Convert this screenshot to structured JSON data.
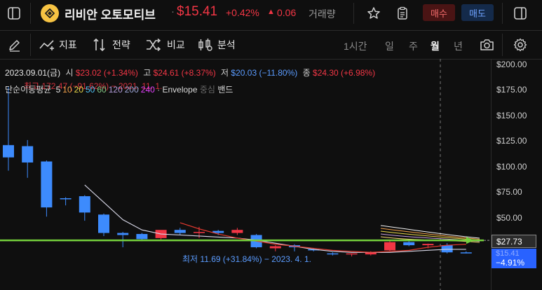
{
  "header": {
    "symbol_name": "리비안 오토모티브",
    "price": "$15.41",
    "change_pct": "+0.42%",
    "change_abs": "0.06",
    "volume_label": "거래량",
    "buy_label": "매수",
    "sell_label": "매도"
  },
  "toolbar": {
    "indicators_label": "지표",
    "strategy_label": "전략",
    "compare_label": "비교",
    "analysis_label": "분석",
    "timeframes": [
      "1시간",
      "일",
      "주",
      "월",
      "년"
    ],
    "active_timeframe": "월"
  },
  "legend": {
    "date": "2023.09.01(금)",
    "open_label": "시",
    "open_value": "$23.02 (+1.34%)",
    "high_label": "고",
    "high_value": "$24.61 (+8.37%)",
    "low_label": "저",
    "low_value": "$20.03 (−11.80%)",
    "close_label": "종",
    "close_value": "$24.30 (+6.98%)",
    "ma_name": "단순이동평균",
    "ma_periods": [
      "5",
      "10",
      "20",
      "50",
      "60",
      "120",
      "200",
      "240"
    ],
    "ma_colors": [
      "#e6e6e6",
      "#f2a14b",
      "#e8d84a",
      "#4fc3f7",
      "#81c784",
      "#b39ddb",
      "#9fa8da",
      "#e040fb"
    ],
    "envelope_label": "· Envelope",
    "center_label": "중심",
    "band_label": "밴드",
    "overlap_text": "최고 172.47 (−91.62%) − 2021. 11. 1."
  },
  "annotations": {
    "low_marker": "최저 11.69 (+31.84%) − 2023. 4. 1."
  },
  "price_axis": {
    "ticks": [
      "$200.00",
      "$175.00",
      "$150.00",
      "$125.00",
      "$100.00",
      "$75.00",
      "$50.00",
      "$15.41"
    ],
    "current_label": "$27.73",
    "current_change": "−4.91%"
  },
  "colors": {
    "up": "#f23645",
    "down": "#2962ff",
    "candle_down": "#3d8bfd",
    "green_line": "#76d13d",
    "accent_red": "#f23645",
    "accent_blue": "#5b9cff"
  },
  "chart_data": {
    "type": "candlestick",
    "interval": "monthly",
    "ylim": [
      0,
      200
    ],
    "candles": [
      {
        "o": 121,
        "h": 178,
        "l": 96,
        "c": 109
      },
      {
        "o": 120,
        "h": 126,
        "l": 89,
        "c": 104
      },
      {
        "o": 105,
        "h": 106,
        "l": 51,
        "c": 60
      },
      {
        "o": 69,
        "h": 70,
        "l": 62,
        "c": 68
      },
      {
        "o": 71,
        "h": 72,
        "l": 47,
        "c": 55
      },
      {
        "o": 53,
        "h": 54,
        "l": 32,
        "c": 35
      },
      {
        "o": 35,
        "h": 36,
        "l": 21,
        "c": 33
      },
      {
        "o": 34,
        "h": 35,
        "l": 27,
        "c": 29
      },
      {
        "o": 30,
        "h": 37,
        "l": 28,
        "c": 38
      },
      {
        "o": 38,
        "h": 40,
        "l": 33,
        "c": 35
      },
      {
        "o": 35,
        "h": 41,
        "l": 30,
        "c": 36
      },
      {
        "o": 37,
        "h": 38,
        "l": 33,
        "c": 35
      },
      {
        "o": 35,
        "h": 40,
        "l": 33,
        "c": 38
      },
      {
        "o": 33,
        "h": 34,
        "l": 20,
        "c": 21
      },
      {
        "o": 20,
        "h": 23,
        "l": 17,
        "c": 22
      },
      {
        "o": 23,
        "h": 24,
        "l": 17,
        "c": 21
      },
      {
        "o": 19,
        "h": 20,
        "l": 17,
        "c": 18
      },
      {
        "o": 15,
        "h": 16,
        "l": 13,
        "c": 14
      },
      {
        "o": 14,
        "h": 15,
        "l": 12,
        "c": 15
      },
      {
        "o": 14,
        "h": 17,
        "l": 13,
        "c": 16
      },
      {
        "o": 18,
        "h": 28,
        "l": 17,
        "c": 26
      },
      {
        "o": 26,
        "h": 28,
        "l": 22,
        "c": 23
      },
      {
        "o": 23,
        "h": 24.61,
        "l": 20.03,
        "c": 24.3
      },
      {
        "o": 23,
        "h": 25,
        "l": 15,
        "c": 16
      },
      {
        "o": 16,
        "h": 17,
        "l": 15,
        "c": 15.41
      }
    ],
    "ma_line": [
      null,
      null,
      null,
      null,
      82,
      65,
      48,
      38,
      34,
      33,
      32,
      31,
      30,
      28,
      25,
      22,
      19,
      17,
      16,
      16,
      16,
      17,
      18,
      19,
      19
    ],
    "ma_long": [
      null,
      null,
      null,
      null,
      null,
      null,
      null,
      null,
      null,
      45,
      39,
      34,
      30,
      27,
      24,
      22,
      20,
      18,
      17,
      16,
      17,
      18,
      21,
      23,
      24
    ],
    "horizontal_level": 27.73
  }
}
